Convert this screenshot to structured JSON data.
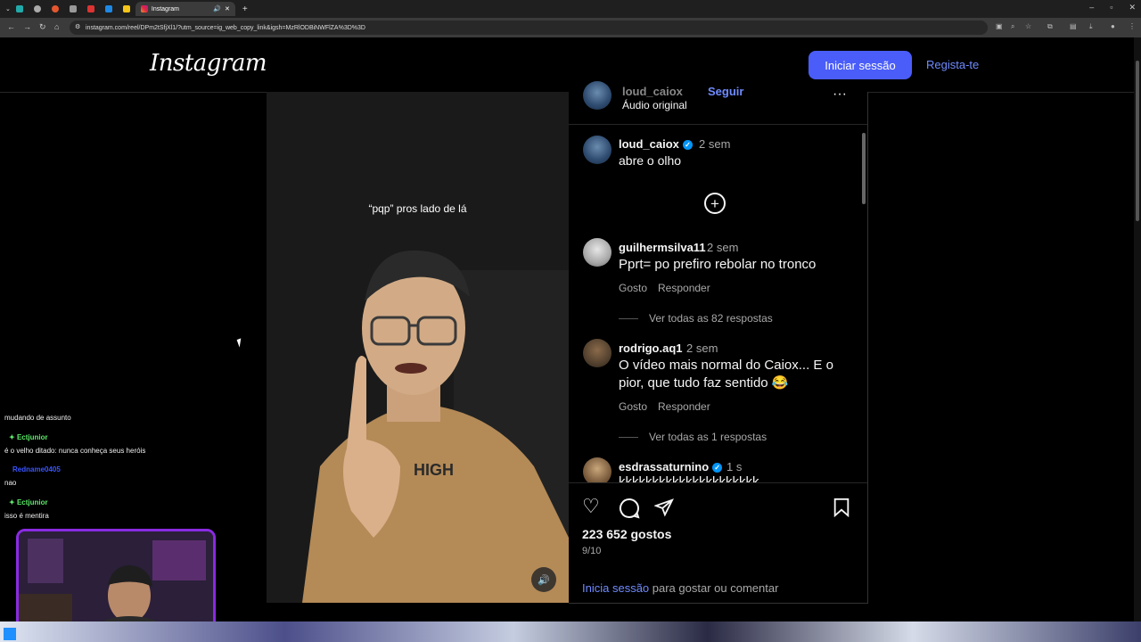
{
  "browser": {
    "active_tab_title": "Instagram",
    "url": "instagram.com/reel/DPm2tSfjXl1/?utm_source=ig_web_copy_link&igsh=MzRlODBiNWFlZA%3D%3D"
  },
  "header": {
    "logo_text": "Instagram",
    "login_button": "Iniciar sessão",
    "register_link": "Regista-te"
  },
  "video": {
    "caption": "“pqp” pros lado de lá"
  },
  "post": {
    "top_username": "loud_caiox",
    "top_follow": "Seguir",
    "audio_label": "Áudio original",
    "author": "loud_caiox",
    "author_time": "2 sem",
    "author_caption": "abre o olho",
    "likes": "223 652 gostos",
    "date": "9/10",
    "login_prompt_link": "Inicia sessão",
    "login_prompt_rest": " para gostar ou comentar"
  },
  "comments": [
    {
      "username": "guilhermsilva11",
      "time": "2 sem",
      "text": "Pprt= po prefiro rebolar no tronco",
      "like_label": "Gosto",
      "reply_label": "Responder",
      "view_replies": "Ver todas as 82 respostas"
    },
    {
      "username": "rodrigo.aq1",
      "time": "2 sem",
      "text": "O vídeo mais normal do Caiox... E o pior, que tudo faz sentido 😂",
      "like_label": "Gosto",
      "reply_label": "Responder",
      "view_replies": "Ver todas as 1 respostas"
    },
    {
      "username": "esdrassaturnino",
      "time": "1 s",
      "text": "kkkkkkkkkkkkkkkkkkkkk"
    }
  ],
  "stream_chat": [
    {
      "kind": "msg",
      "text": "mudando de assunto"
    },
    {
      "kind": "user",
      "text": "Ectjunior"
    },
    {
      "kind": "msg",
      "text": "é o velho ditado: nunca conheça seus heróis"
    },
    {
      "kind": "user2",
      "text": "Redname0405"
    },
    {
      "kind": "msg",
      "text": "nao"
    },
    {
      "kind": "user",
      "text": "Ectjunior"
    },
    {
      "kind": "msg",
      "text": "isso é mentira"
    }
  ],
  "colors": {
    "primary_button": "#4a5df9",
    "link": "#6f8bff",
    "verified": "#0095f6",
    "webcam_border": "#8a2be2"
  }
}
